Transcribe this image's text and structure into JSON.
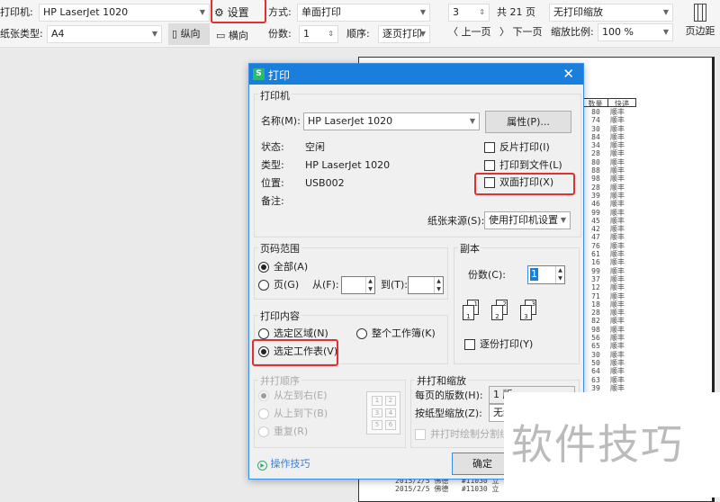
{
  "toolbar": {
    "printer_label": "打印机:",
    "printer_value": "HP LaserJet 1020",
    "settings_label": "设置",
    "mode_label": "方式:",
    "mode_value": "单面打印",
    "page_value": "3",
    "total_pages": "共 21 页",
    "scale_mode": "无打印缩放",
    "margins_label": "页边距",
    "paper_label": "纸张类型:",
    "paper_value": "A4",
    "portrait_label": "纵向",
    "landscape_label": "横向",
    "copies_label": "份数:",
    "copies_value": "1",
    "order_label": "顺序:",
    "order_value": "逐页打印",
    "prev_page": "上一页",
    "next_page": "下一页",
    "zoom_label": "缩放比例:",
    "zoom_value": "100 %"
  },
  "preview": {
    "headers": [
      "数量",
      "快递"
    ],
    "quantities": [
      "80",
      "74",
      "30",
      "84",
      "34",
      "28",
      "80",
      "88",
      "98",
      "28",
      "39",
      "46",
      "99",
      "45",
      "42",
      "47",
      "76",
      "61",
      "16",
      "99",
      "37",
      "12",
      "71",
      "18",
      "28",
      "82",
      "98",
      "56",
      "65",
      "30",
      "50",
      "64",
      "63",
      "39"
    ],
    "courier": "顺丰",
    "bottom_rows": [
      [
        "2015/2/5",
        "佛德",
        "#11030",
        "立"
      ],
      [
        "2015/2/5",
        "佛德",
        "#11030",
        "立"
      ]
    ]
  },
  "dialog": {
    "title": "打印",
    "printer_group": "打印机",
    "name_label": "名称(M):",
    "name_value": "HP LaserJet 1020",
    "properties_button": "属性(P)...",
    "status_label": "状态:",
    "status_value": "空闲",
    "type_label": "类型:",
    "type_value": "HP LaserJet 1020",
    "location_label": "位置:",
    "location_value": "USB002",
    "comment_label": "备注:",
    "reverse_print": "反片打印(I)",
    "print_to_file": "打印到文件(L)",
    "duplex_print": "双面打印(X)",
    "paper_source_label": "纸张来源(S):",
    "paper_source_value": "使用打印机设置",
    "page_range_group": "页码范围",
    "all_label": "全部(A)",
    "pages_label": "页(G)",
    "from_label": "从(F):",
    "to_label": "到(T):",
    "copies_group": "副本",
    "copies_label": "份数(C):",
    "copies_value": "1",
    "collate_label": "逐份打印(Y)",
    "content_group": "打印内容",
    "selection_label": "选定区域(N)",
    "workbook_label": "整个工作簿(K)",
    "sheet_label": "选定工作表(V)",
    "order_group": "并打顺序",
    "ltr_label": "从左到右(E)",
    "ttb_label": "从上到下(B)",
    "repeat_label": "重复(R)",
    "grid_numbers": [
      "1",
      "2",
      "3",
      "4",
      "5",
      "6"
    ],
    "zoom_group": "并打和缩放",
    "pages_per_sheet_label": "每页的版数(H):",
    "pages_per_sheet_value": "1 版",
    "scale_to_paper_label": "按纸型缩放(Z):",
    "scale_to_paper_value": "无缩放",
    "draw_lines_label": "并打时绘制分割线",
    "tips_link": "操作技巧",
    "ok_button": "确定"
  },
  "watermark": "软件技巧"
}
